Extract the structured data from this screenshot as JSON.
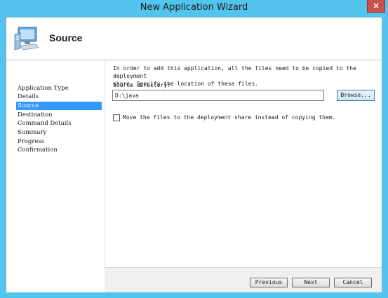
{
  "window": {
    "title": "New Application Wizard",
    "close_glyph": "×"
  },
  "header": {
    "title": "Source",
    "icon": "computer-icon"
  },
  "steps": [
    {
      "label": "Application Type",
      "active": false
    },
    {
      "label": "Details",
      "active": false
    },
    {
      "label": "Source",
      "active": true
    },
    {
      "label": "Destination",
      "active": false
    },
    {
      "label": "Command Details",
      "active": false
    },
    {
      "label": "Summary",
      "active": false
    },
    {
      "label": "Progress",
      "active": false
    },
    {
      "label": "Confirmation",
      "active": false
    }
  ],
  "content": {
    "intro_line1": "In order to add this application, all the files need to be copied to the deployment",
    "intro_line2": "share.  Specify the location of these files.",
    "source_label": "Source directory:",
    "source_value": "D:\\java",
    "browse_label": "Browse...",
    "move_checked": false,
    "move_label": "Move the files to the deployment share instead of copying them."
  },
  "footer": {
    "previous_label": "Previous",
    "next_label": "Next",
    "cancel_label": "Cancel"
  },
  "colors": {
    "titlebar": "#52c4ee",
    "selection": "#3399ff",
    "close": "#c7504a"
  }
}
